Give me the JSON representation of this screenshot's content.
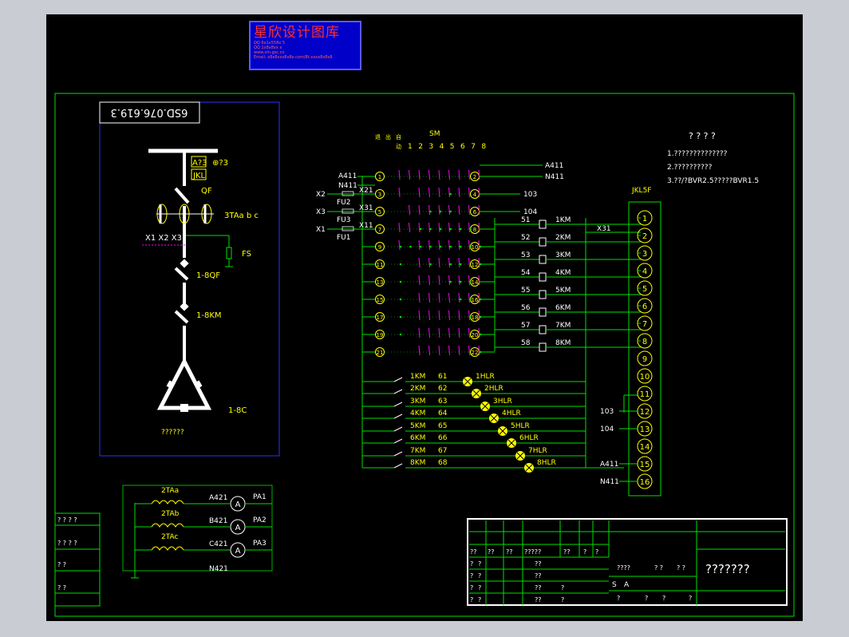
{
  "logo": {
    "title": "星欣设计图库",
    "lines": [
      "QQ 6x1x558x 5",
      "QQ 1x8x8xx x",
      "www.xin.gsc.cn",
      "Email: x8x8xxx8x8x.com/8t.xxxx8x8x8"
    ]
  },
  "colors": {
    "frame": "#00e000",
    "wire": "#00e000",
    "text": "#ffff00",
    "switch": "#ff00ff",
    "blue_box": "#3030ff",
    "white": "#ffffff"
  },
  "drawing_number": "6SD.076.619.3",
  "left_circuit": {
    "bus_labels": [
      "A?3",
      "⊕?3"
    ],
    "jkl": "JKL",
    "qf": "QF",
    "ct_label": "3TAa b c",
    "x_labels": "X1  X2  X3",
    "fs": "FS",
    "breaker": "1-8QF",
    "contactor": "1-8KM",
    "capacitor": "1-8C",
    "note": "??????"
  },
  "switch_header": {
    "sm": "SM",
    "cols": [
      "1",
      "2",
      "3",
      "4",
      "5",
      "6",
      "7",
      "8"
    ],
    "col_prefix": [
      "退",
      "出",
      "自",
      "动"
    ]
  },
  "switch_left": [
    "A411",
    "N411",
    "X2",
    "X21",
    "FU2",
    "X3",
    "X31",
    "FU3",
    "X1",
    "X11",
    "FU1"
  ],
  "terminals_left": [
    "1",
    "3",
    "5",
    "7",
    "9",
    "11",
    "13",
    "15",
    "17",
    "19",
    "21"
  ],
  "terminals_right": [
    "2",
    "4",
    "6",
    "8",
    "10",
    "12",
    "14",
    "16",
    "18",
    "20",
    "22"
  ],
  "right_wires": [
    "A411",
    "N411",
    "103",
    "104"
  ],
  "coil_rows": [
    {
      "num": "51",
      "coil": "1KM"
    },
    {
      "num": "52",
      "coil": "2KM"
    },
    {
      "num": "53",
      "coil": "3KM"
    },
    {
      "num": "54",
      "coil": "4KM"
    },
    {
      "num": "55",
      "coil": "5KM"
    },
    {
      "num": "56",
      "coil": "6KM"
    },
    {
      "num": "57",
      "coil": "7KM"
    },
    {
      "num": "58",
      "coil": "8KM"
    }
  ],
  "x31": "X31",
  "lamp_rows": [
    {
      "km": "1KM",
      "num": "61",
      "lamp": "1HLR"
    },
    {
      "km": "2KM",
      "num": "62",
      "lamp": "2HLR"
    },
    {
      "km": "3KM",
      "num": "63",
      "lamp": "3HLR"
    },
    {
      "km": "4KM",
      "num": "64",
      "lamp": "4HLR"
    },
    {
      "km": "5KM",
      "num": "65",
      "lamp": "5HLR"
    },
    {
      "km": "6KM",
      "num": "66",
      "lamp": "6HLR"
    },
    {
      "km": "7KM",
      "num": "67",
      "lamp": "7HLR"
    },
    {
      "km": "8KM",
      "num": "68",
      "lamp": "8HLR"
    }
  ],
  "jkl5f": {
    "title": "JKL5F",
    "terminals": [
      "1",
      "2",
      "3",
      "4",
      "5",
      "6",
      "7",
      "8",
      "9",
      "10",
      "11",
      "12",
      "13",
      "14",
      "15",
      "16"
    ],
    "side_labels": {
      "12": "103",
      "13": "104",
      "15": "A411",
      "16": "N411"
    }
  },
  "notes": {
    "title": "? ? ? ?",
    "items": [
      "1.??????????????",
      "2.??????????",
      "3.??/?BVR2.5?????BVR1.5"
    ]
  },
  "meter": {
    "ct": [
      "2TAa",
      "2TAb",
      "2TAc"
    ],
    "phases": [
      "A421",
      "B421",
      "C421"
    ],
    "meters": [
      "PA1",
      "PA2",
      "PA3"
    ],
    "neutral": "N421",
    "symbol": "A"
  },
  "left_table": [
    "? ? ? ?",
    "? ? ? ?",
    "? ?",
    "? ?"
  ],
  "title_block": {
    "row1": [
      "??",
      "??",
      "??",
      "?????",
      "??",
      "?",
      "?"
    ],
    "r2": [
      "?",
      "?",
      "??"
    ],
    "r3": [
      "?",
      "?",
      "??"
    ],
    "r4": [
      "?",
      "?",
      "??",
      "?"
    ],
    "r5": [
      "?",
      "?",
      "??",
      "?"
    ],
    "mid": [
      "????",
      "? ?",
      "? ?"
    ],
    "sa": [
      "S",
      "A"
    ],
    "bottom": [
      "?",
      "?",
      "?",
      "?"
    ],
    "big": "???????"
  }
}
